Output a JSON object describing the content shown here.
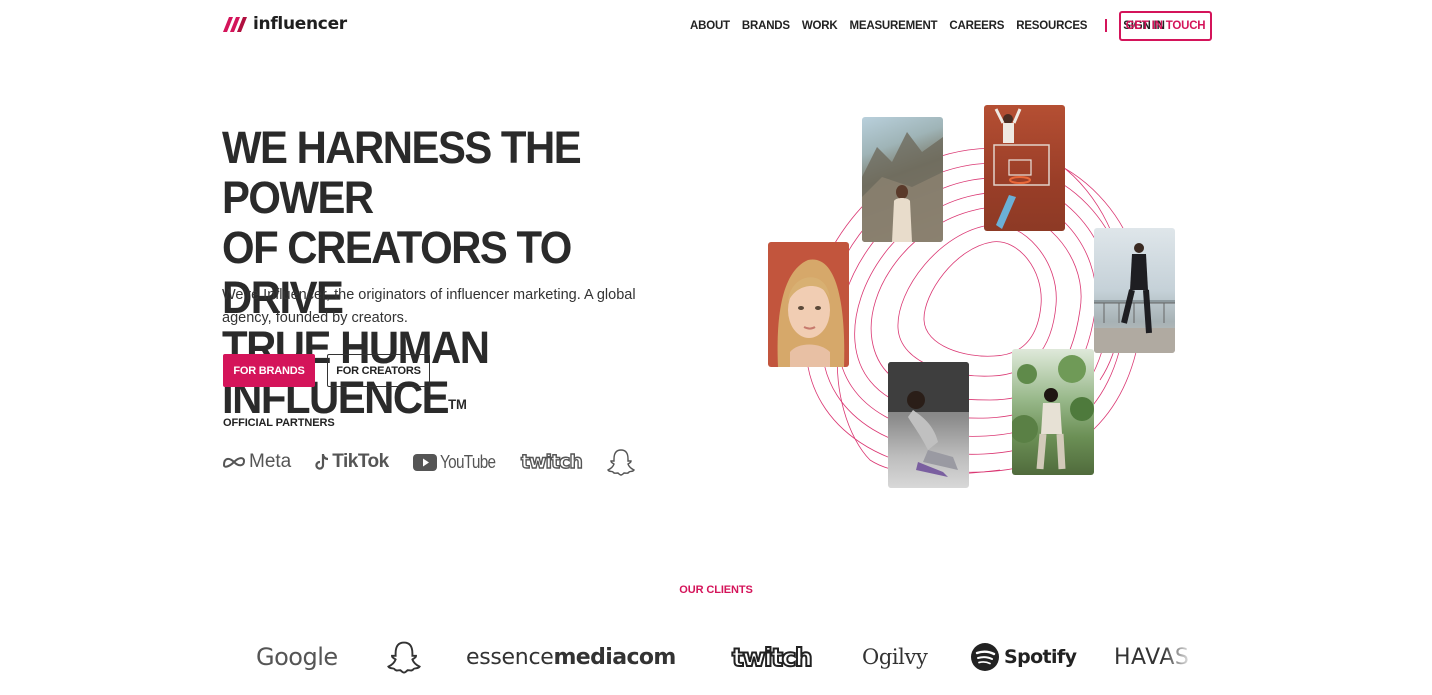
{
  "header": {
    "logo_text": "influencer",
    "nav": [
      "ABOUT",
      "BRANDS",
      "WORK",
      "MEASUREMENT",
      "CAREERS",
      "RESOURCES"
    ],
    "sign_in": "SIGN IN",
    "cta": "GET IN TOUCH"
  },
  "hero": {
    "headline_lines": [
      "WE HARNESS THE POWER",
      "OF CREATORS TO DRIVE",
      "TRUE HUMAN INFLUENCE"
    ],
    "trademark": "TM",
    "subtitle": "We're Influencer, the originators of influencer marketing. A global agency, founded by creators.",
    "btn_brands": "FOR BRANDS",
    "btn_creators": "FOR CREATORS",
    "partners_title": "OFFICIAL PARTNERS",
    "partners": {
      "meta": "Meta",
      "tiktok": "TikTok",
      "youtube": "YouTube",
      "twitch": "twitch",
      "snapchat_icon": "snapchat-ghost-icon"
    }
  },
  "clients": {
    "title": "OUR CLIENTS",
    "google": "Google",
    "snapchat_icon": "snapchat-ghost-icon",
    "essence": "essence",
    "mediacom": "mediacom",
    "twitch": "twitch",
    "ogilvy": "Ogilvy",
    "spotify": "Spotify",
    "havas": "HAVAS"
  },
  "colors": {
    "accent": "#d4145a",
    "text": "#222222"
  }
}
